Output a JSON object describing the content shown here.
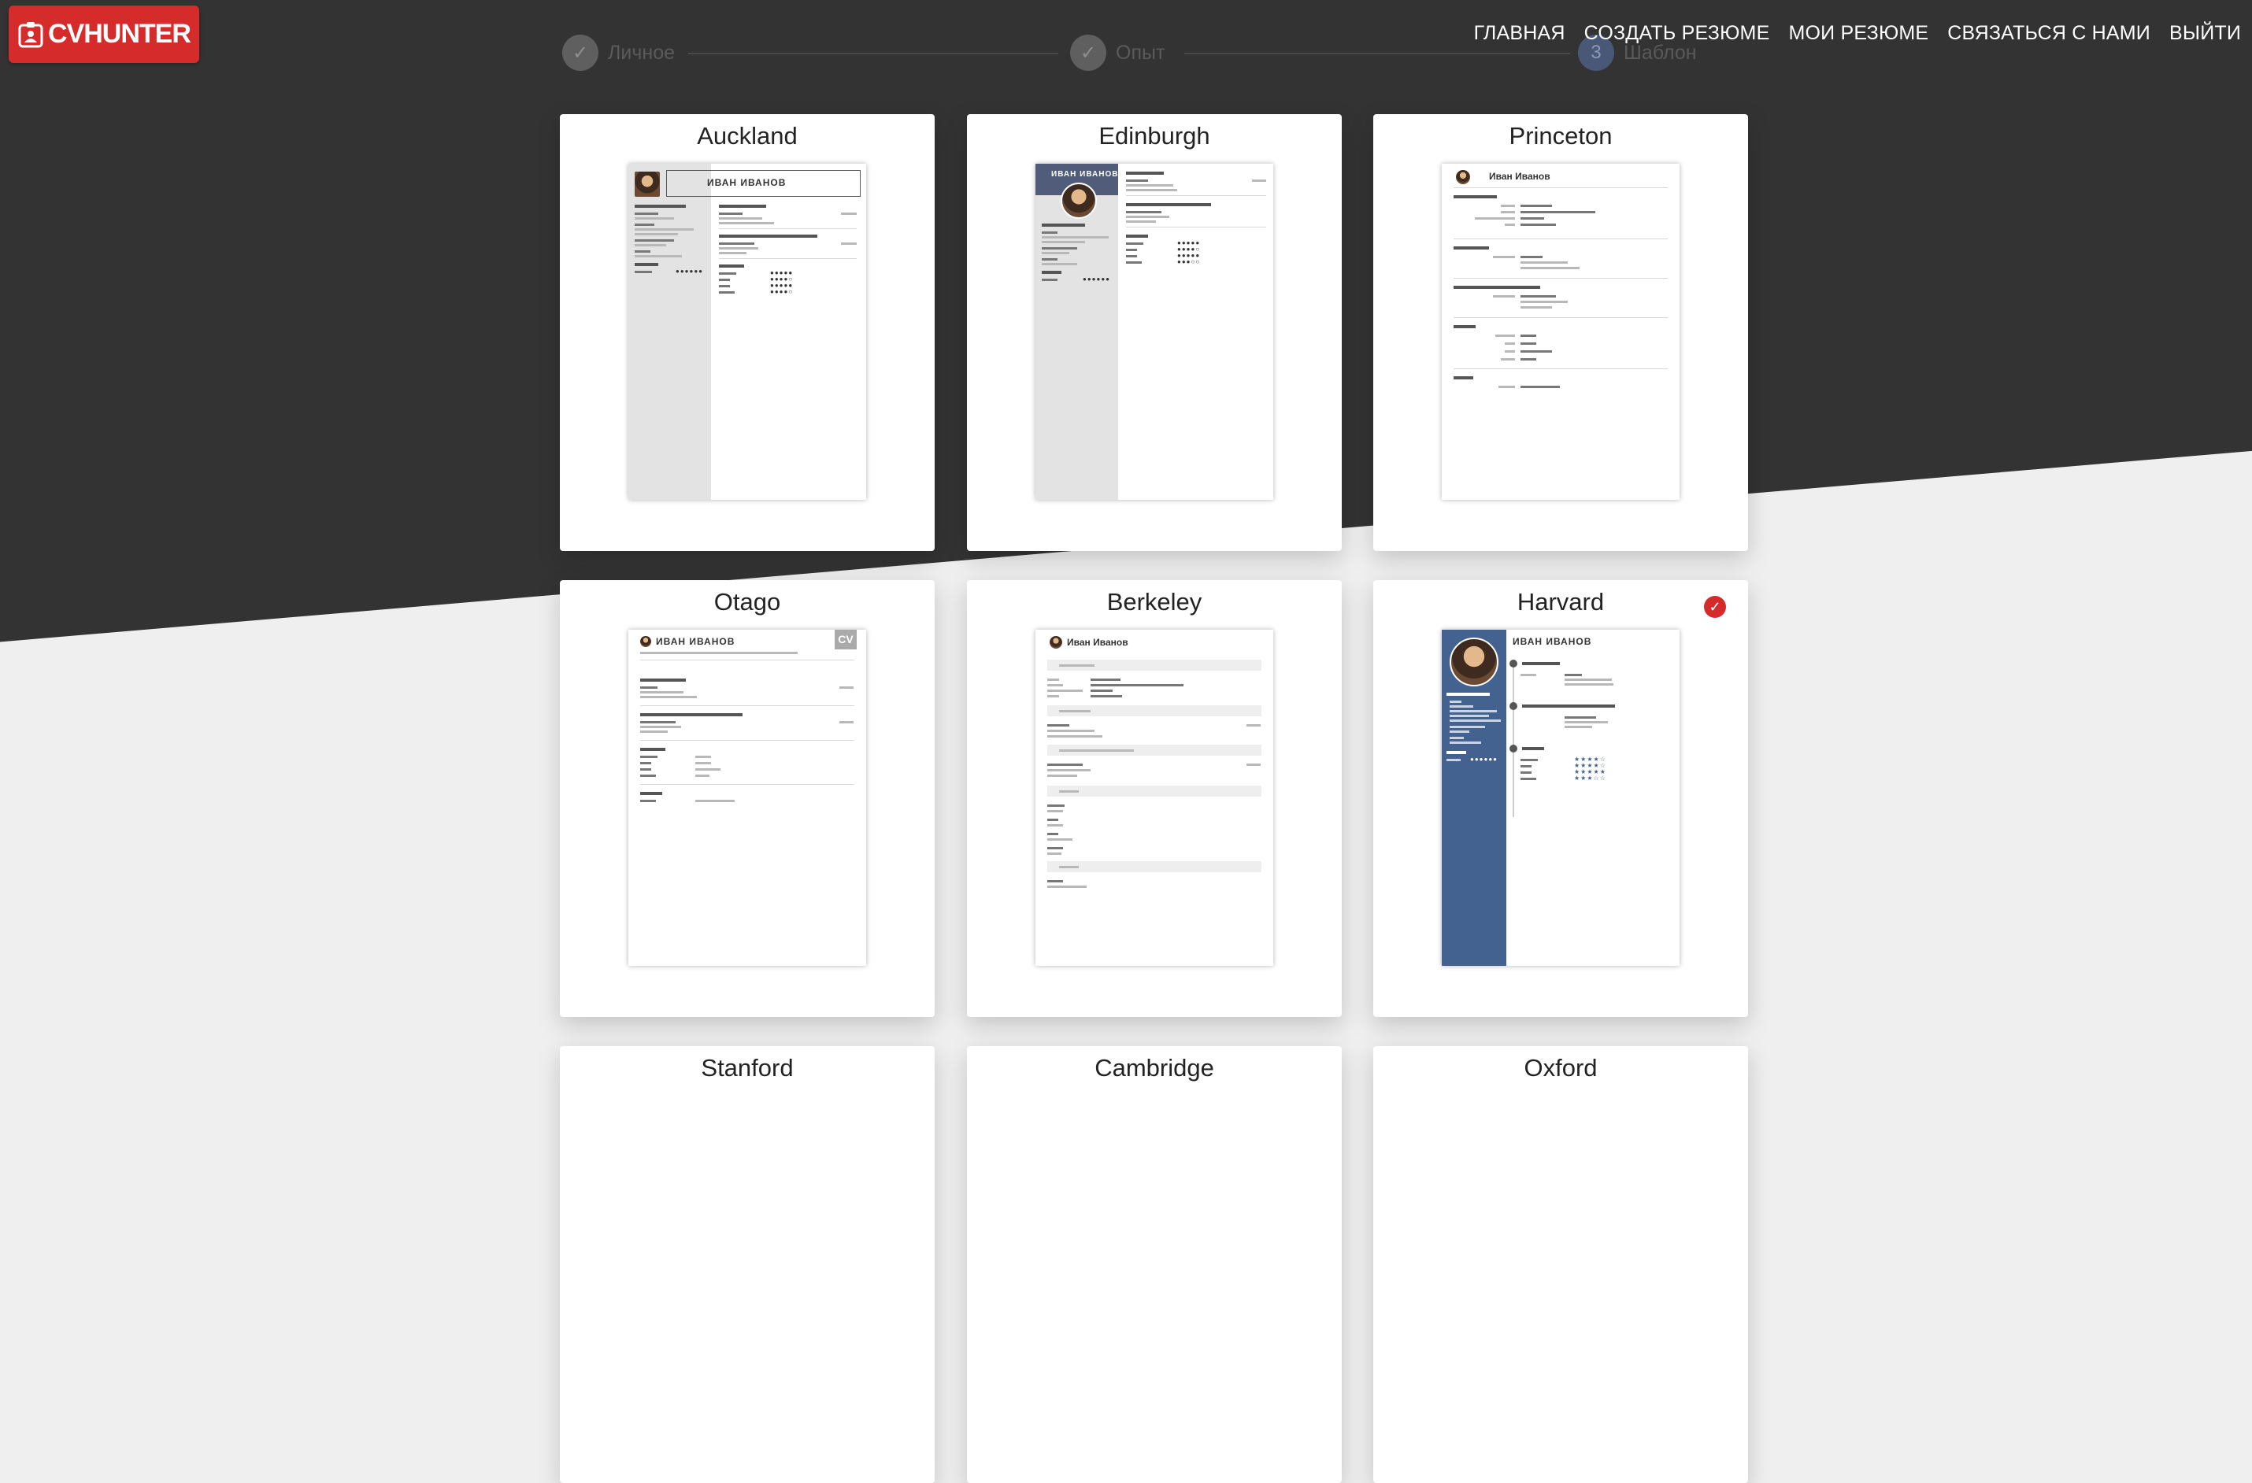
{
  "brand": {
    "name": "CVHUNTER"
  },
  "nav": [
    "ГЛАВНАЯ",
    "СОЗДАТЬ РЕЗЮМЕ",
    "МОИ РЕЗЮМЕ",
    "СВЯЗАТЬСЯ С НАМИ",
    "ВЫЙТИ"
  ],
  "steps": [
    {
      "label": "Личное",
      "state": "done"
    },
    {
      "label": "Опыт",
      "state": "done"
    },
    {
      "label": "Шаблон",
      "number": "3",
      "state": "active"
    }
  ],
  "templates": [
    {
      "title": "Auckland",
      "selected": false
    },
    {
      "title": "Edinburgh",
      "selected": false
    },
    {
      "title": "Princeton",
      "selected": false
    },
    {
      "title": "Otago",
      "selected": false
    },
    {
      "title": "Berkeley",
      "selected": false
    },
    {
      "title": "Harvard",
      "selected": true
    },
    {
      "title": "Stanford",
      "selected": false
    },
    {
      "title": "Cambridge",
      "selected": false
    },
    {
      "title": "Oxford",
      "selected": false
    }
  ],
  "resume_sample": {
    "name_upper": "ИВАН ИВАНОВ",
    "name": "Иван Иванов",
    "badge": "CV"
  },
  "colors": {
    "accent": "#d62b2b",
    "dark_bg": "#333333",
    "light_bg": "#efefef",
    "harvard_sidebar": "#43628f",
    "edinburgh_sidebar": "#505c7a"
  }
}
